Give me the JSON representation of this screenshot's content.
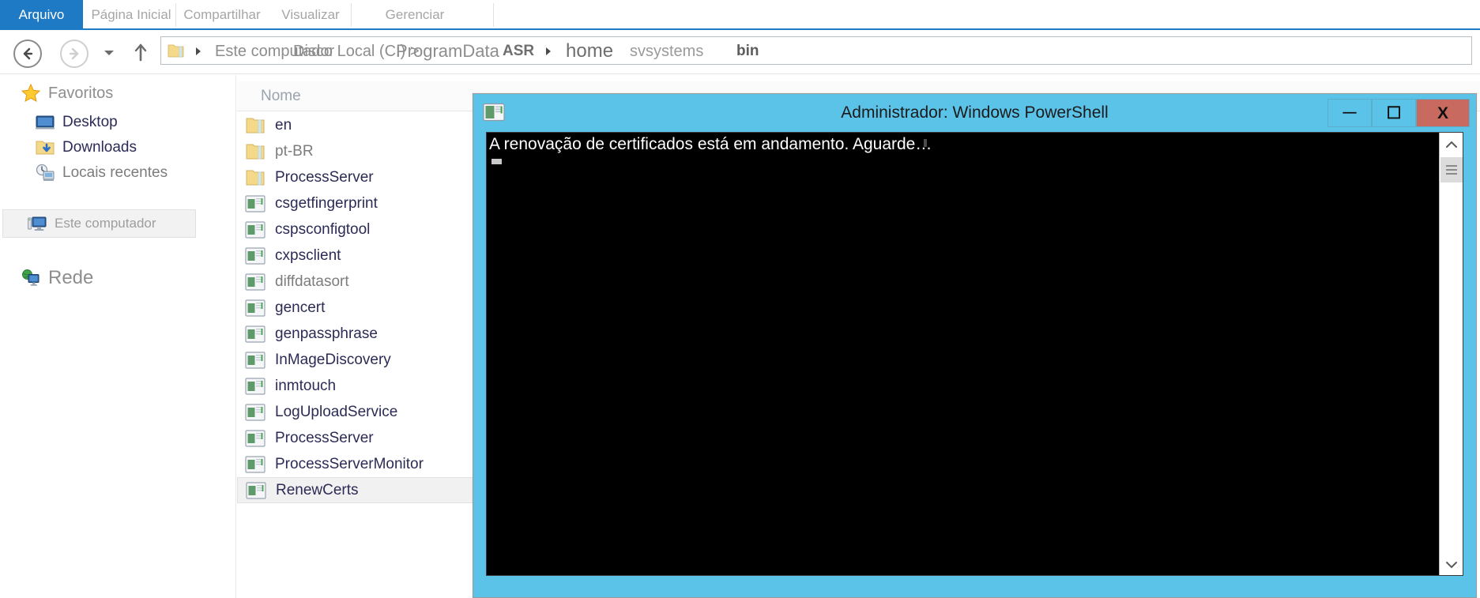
{
  "explorer": {
    "ribbon": {
      "tabs": [
        {
          "label": "Arquivo",
          "active": true
        },
        {
          "label": "Página Inicial",
          "active": false
        },
        {
          "label": "Compartilhar",
          "active": false
        },
        {
          "label": "Visualizar",
          "active": false
        },
        {
          "label": "Gerenciar",
          "active": false
        }
      ],
      "accent_color": "#1e7ac4"
    },
    "address_bar": {
      "back_label": "Voltar",
      "forward_label": "Avançar",
      "recent_dropdown_label": "Locais recentes",
      "up_label": "Acima",
      "breadcrumbs": [
        "Este computador",
        "Disco Local (C:) >",
        "ProgramData",
        "ASR",
        "home",
        "svsystems",
        "bin"
      ]
    },
    "nav_pane": {
      "items": [
        {
          "label": "Favoritos",
          "icon": "star-icon",
          "selected": false
        },
        {
          "label": "Desktop",
          "icon": "desktop-icon",
          "selected": false
        },
        {
          "label": "Downloads",
          "icon": "downloads-folder-icon",
          "selected": false
        },
        {
          "label": "Locais recentes",
          "icon": "recent-places-icon",
          "selected": false
        },
        {
          "label": "Este computador",
          "icon": "this-pc-icon",
          "selected": true
        },
        {
          "label": "Rede",
          "icon": "network-icon",
          "selected": false
        }
      ]
    },
    "file_list": {
      "columns": [
        "Nome"
      ],
      "rows": [
        {
          "name": "en",
          "type": "folder",
          "selected": false
        },
        {
          "name": "pt-BR",
          "type": "folder",
          "selected": false
        },
        {
          "name": "ProcessServer",
          "type": "folder",
          "selected": false
        },
        {
          "name": "csgetfingerprint",
          "type": "application",
          "selected": false
        },
        {
          "name": "cspsconfigtool",
          "type": "application",
          "selected": false
        },
        {
          "name": "cxpsclient",
          "type": "application",
          "selected": false
        },
        {
          "name": "diffdatasort",
          "type": "application",
          "selected": false
        },
        {
          "name": "gencert",
          "type": "application",
          "selected": false
        },
        {
          "name": "genpassphrase",
          "type": "application",
          "selected": false
        },
        {
          "name": "InMageDiscovery",
          "type": "application",
          "selected": false
        },
        {
          "name": "inmtouch",
          "type": "application",
          "selected": false
        },
        {
          "name": "LogUploadService",
          "type": "application",
          "selected": false
        },
        {
          "name": "ProcessServer",
          "type": "application",
          "selected": false
        },
        {
          "name": "ProcessServerMonitor",
          "type": "application",
          "selected": false
        },
        {
          "name": "RenewCerts",
          "type": "application",
          "selected": true
        }
      ]
    }
  },
  "powershell": {
    "title": "Administrador: Windows PowerShell",
    "titlebar_color": "#5bc2e8",
    "close_color": "#c96a61",
    "buttons": {
      "minimize": "—",
      "maximize": "❐",
      "close": "X"
    },
    "console": {
      "background": "#000000",
      "foreground": "#ffffff",
      "lines": [
        "A renovação de certificados está em andamento. Aguarde…"
      ]
    },
    "scrollbar": {
      "up_label": "Rolar para cima",
      "down_label": "Rolar para baixo",
      "thumb_label": "Barra de rolagem"
    }
  }
}
